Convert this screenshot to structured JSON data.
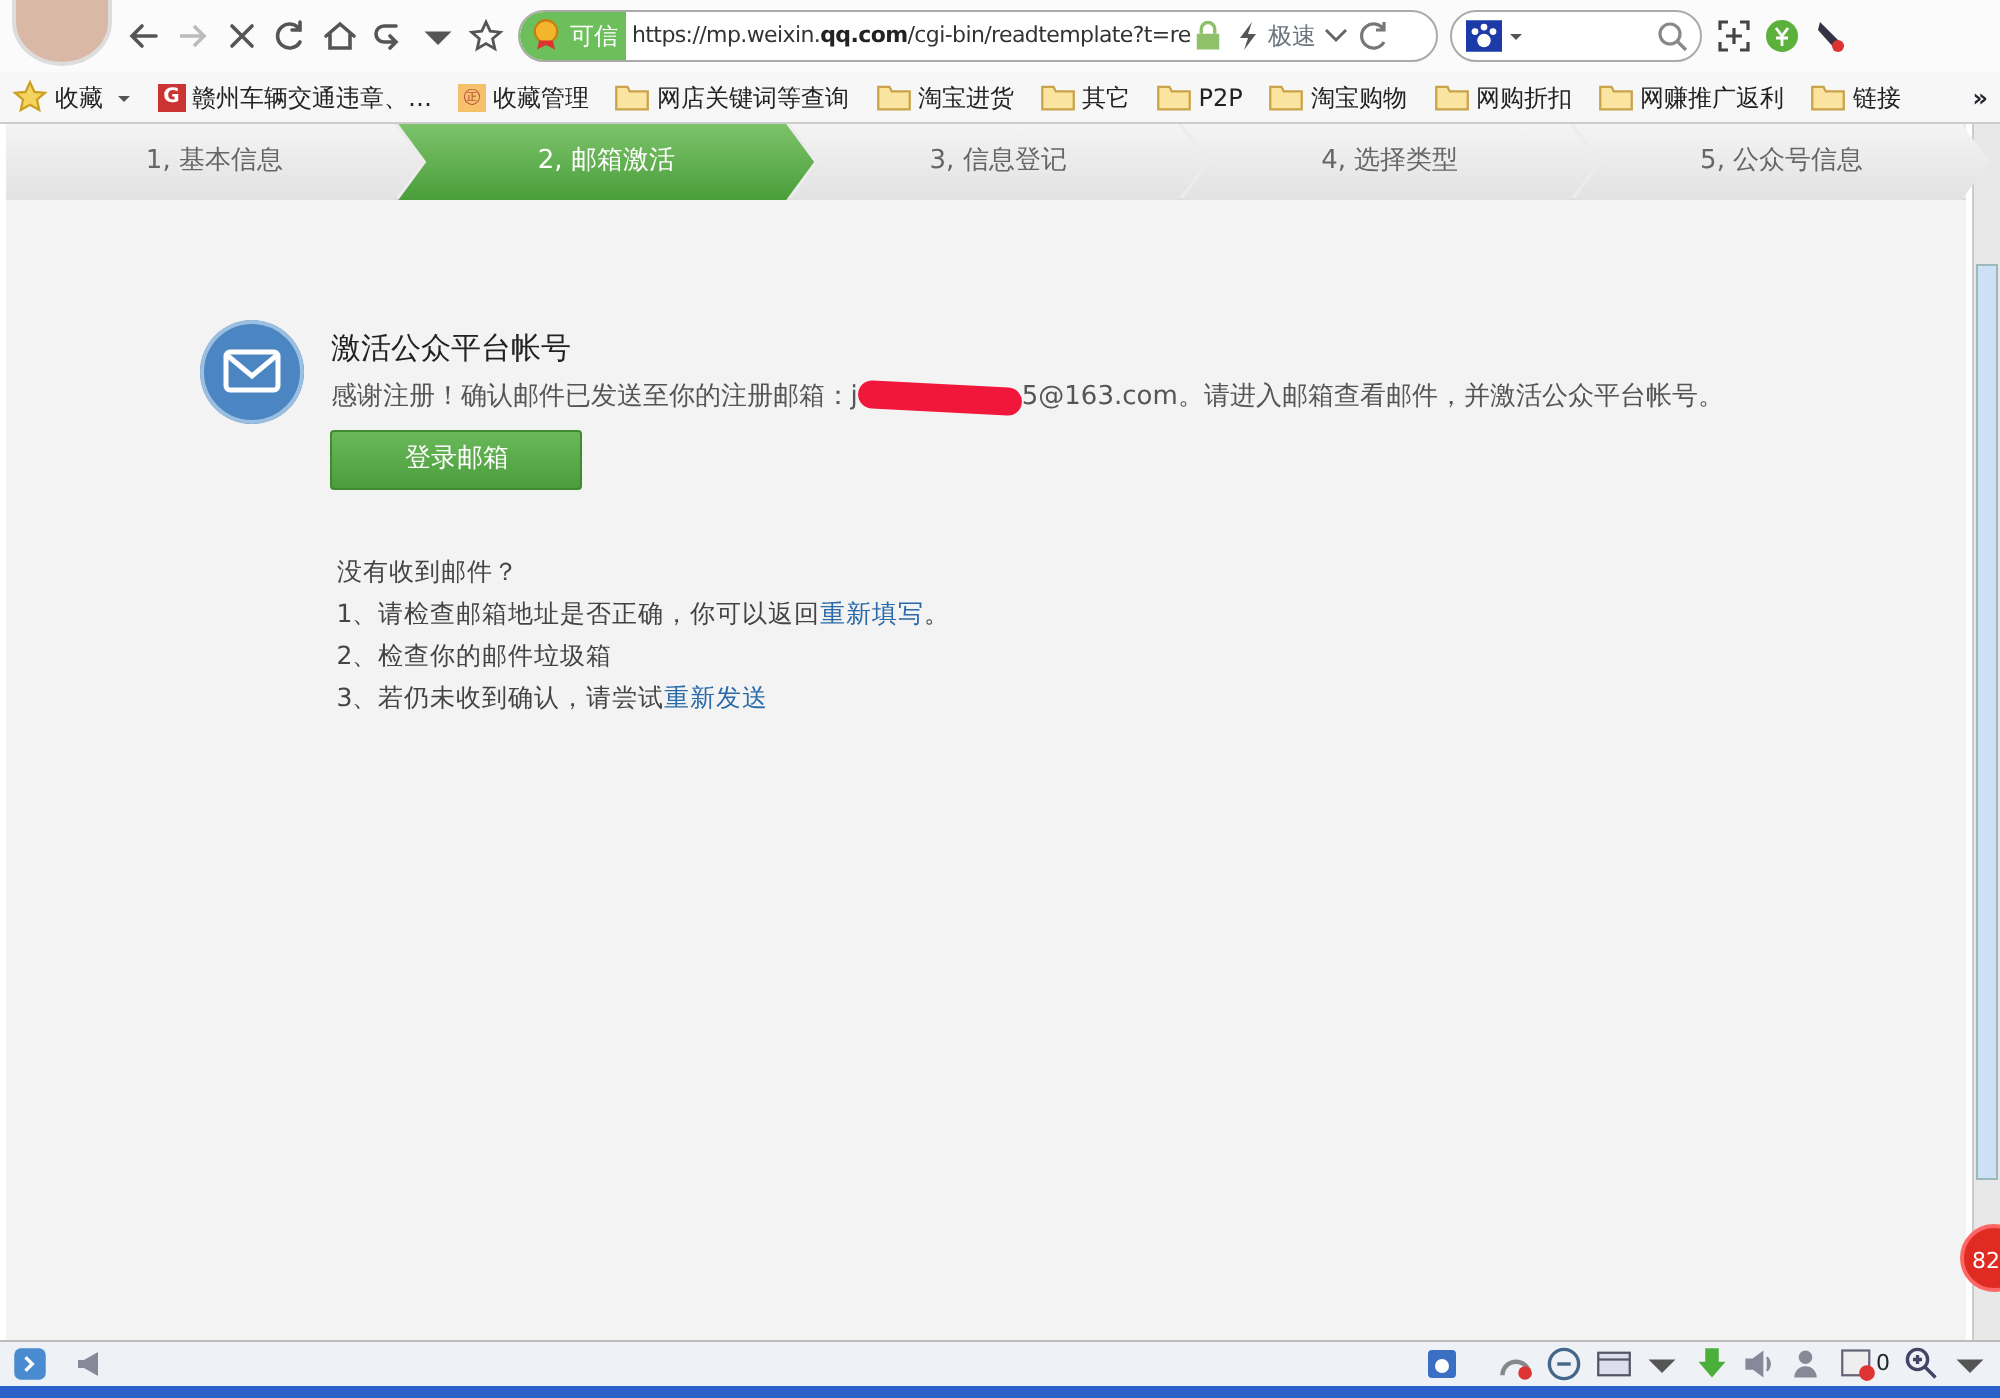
{
  "browser": {
    "address": {
      "trust_label": "可信",
      "url": "https://mp.weixin.**qq.com**/cgi-bin/readtemplate?t=re",
      "speed_label": "极速"
    },
    "bookmarks": [
      {
        "kind": "star",
        "label": "收藏"
      },
      {
        "kind": "site",
        "icon_text": "G",
        "label": "赣州车辆交通违章、…"
      },
      {
        "kind": "manage",
        "icon_text": "㊣",
        "label": "收藏管理"
      },
      {
        "kind": "folder",
        "label": "网店关键词等查询"
      },
      {
        "kind": "folder",
        "label": "淘宝进货"
      },
      {
        "kind": "folder",
        "label": "其它"
      },
      {
        "kind": "folder",
        "label": "P2P"
      },
      {
        "kind": "folder",
        "label": "淘宝购物"
      },
      {
        "kind": "folder",
        "label": "网购折扣"
      },
      {
        "kind": "folder",
        "label": "网赚推广返利"
      },
      {
        "kind": "folder",
        "label": "链接"
      }
    ],
    "more": "»"
  },
  "steps": [
    {
      "label": "1, 基本信息",
      "selected": false
    },
    {
      "label": "2, 邮箱激活",
      "selected": true
    },
    {
      "label": "3, 信息登记",
      "selected": false
    },
    {
      "label": "4, 选择类型",
      "selected": false
    },
    {
      "label": "5, 公众号信息",
      "selected": false
    }
  ],
  "activation": {
    "title": "激活公众平台帐号",
    "message_before": "感谢注册！确认邮件已发送至你的注册邮箱：j",
    "message_after": "5@163.com。请进入邮箱查看邮件，并激活公众平台帐号。",
    "login_button": "登录邮箱"
  },
  "help": {
    "heading": "没有收到邮件？",
    "items": [
      {
        "text": "1、请检查邮箱地址是否正确，你可以返回",
        "link": "重新填写",
        "after": "。"
      },
      {
        "text": "2、检查你的邮件垃圾箱"
      },
      {
        "text": "3、若仍未收到确认，请尝试",
        "link": "重新发送"
      }
    ]
  },
  "floating_badge": "82",
  "status_bar": {
    "blocked_count": "0"
  }
}
